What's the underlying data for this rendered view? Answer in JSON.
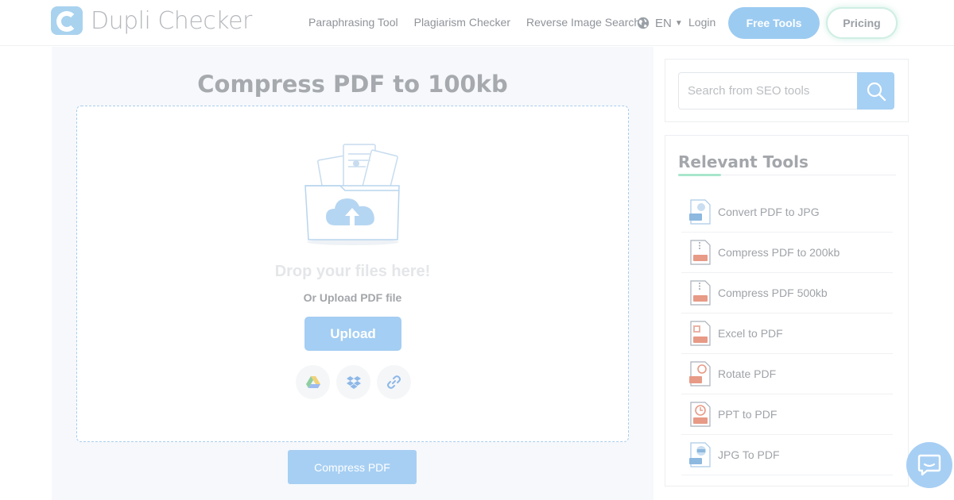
{
  "brand": {
    "name": "Dupli Checker"
  },
  "nav": {
    "links": [
      "Paraphrasing Tool",
      "Plagiarism Checker",
      "Reverse Image Search"
    ],
    "language": "EN",
    "login": "Login",
    "free_tools": "Free Tools",
    "pricing": "Pricing"
  },
  "main": {
    "title": "Compress PDF to 100kb",
    "drop_text": "Drop your files here!",
    "or_upload": "Or Upload PDF file",
    "upload_label": "Upload",
    "sources": [
      "google-drive-icon",
      "dropbox-icon",
      "link-icon"
    ],
    "compress_label": "Compress PDF"
  },
  "sidebar": {
    "search_placeholder": "Search from SEO tools",
    "relevant_title": "Relevant Tools",
    "tools": [
      {
        "label": "Convert PDF to JPG",
        "icon": "pdf-to-jpg-icon",
        "color": "#8db8df"
      },
      {
        "label": "Compress PDF to 200kb",
        "icon": "zip-pdf-icon",
        "color": "#e79a86"
      },
      {
        "label": "Compress PDF 500kb",
        "icon": "zip-pdf-icon",
        "color": "#e79a86"
      },
      {
        "label": "Excel to PDF",
        "icon": "excel-to-pdf-icon",
        "color": "#e79a86"
      },
      {
        "label": "Rotate PDF",
        "icon": "rotate-pdf-icon",
        "color": "#e79a86"
      },
      {
        "label": "PPT to PDF",
        "icon": "ppt-to-pdf-icon",
        "color": "#e79a86"
      },
      {
        "label": "JPG To PDF",
        "icon": "jpg-to-pdf-icon",
        "color": "#8db8df"
      }
    ]
  },
  "colors": {
    "accent": "#a6d0f4",
    "pricing_border": "#cfeee3",
    "title_underline": "#a8e6cc"
  }
}
